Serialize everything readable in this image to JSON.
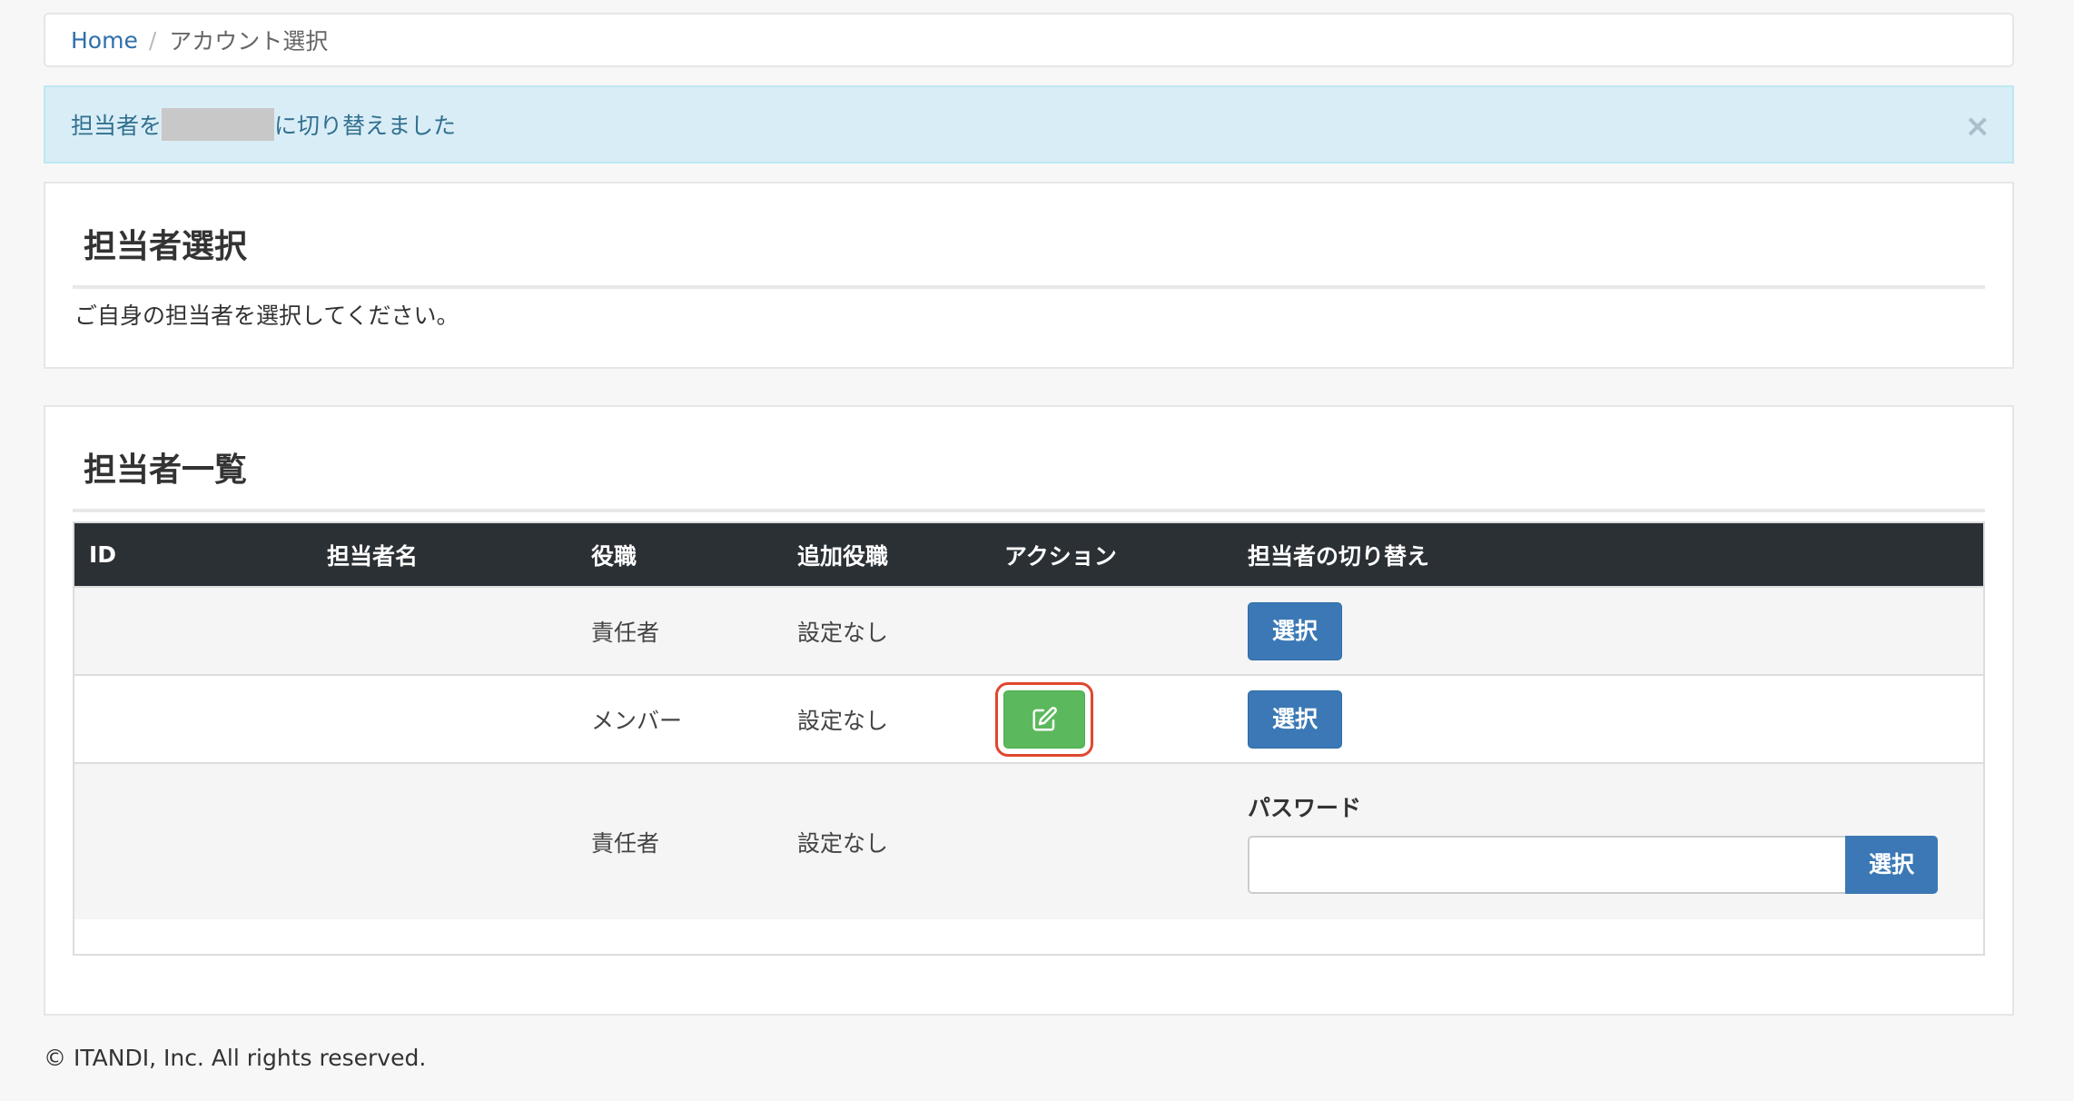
{
  "breadcrumb": {
    "home": "Home",
    "separator": "/",
    "current": "アカウント選択"
  },
  "alert": {
    "prefix": "担当者を",
    "suffix": "に切り替えました",
    "close": "×"
  },
  "selection_panel": {
    "title": "担当者選択",
    "description": "ご自身の担当者を選択してください。"
  },
  "list_panel": {
    "title": "担当者一覧",
    "columns": [
      "ID",
      "担当者名",
      "役職",
      "追加役職",
      "アクション",
      "担当者の切り替え"
    ],
    "rows": [
      {
        "id": "",
        "name": "",
        "role": "責任者",
        "extra_role": "設定なし",
        "select": "選択"
      },
      {
        "id": "",
        "name": "",
        "role": "メンバー",
        "extra_role": "設定なし",
        "select": "選択"
      },
      {
        "id": "",
        "name": "",
        "role": "責任者",
        "extra_role": "設定なし",
        "password_label": "パスワード",
        "select": "選択"
      }
    ]
  },
  "footer": {
    "copyright": "© ITANDI, Inc. All rights reserved."
  },
  "colors": {
    "primary": "#3b78b5",
    "success": "#5cb85c",
    "highlight": "#e0472f",
    "table_header": "#2b3035",
    "alert_bg": "#d9edf7"
  },
  "icons": {
    "edit": "edit-icon"
  }
}
